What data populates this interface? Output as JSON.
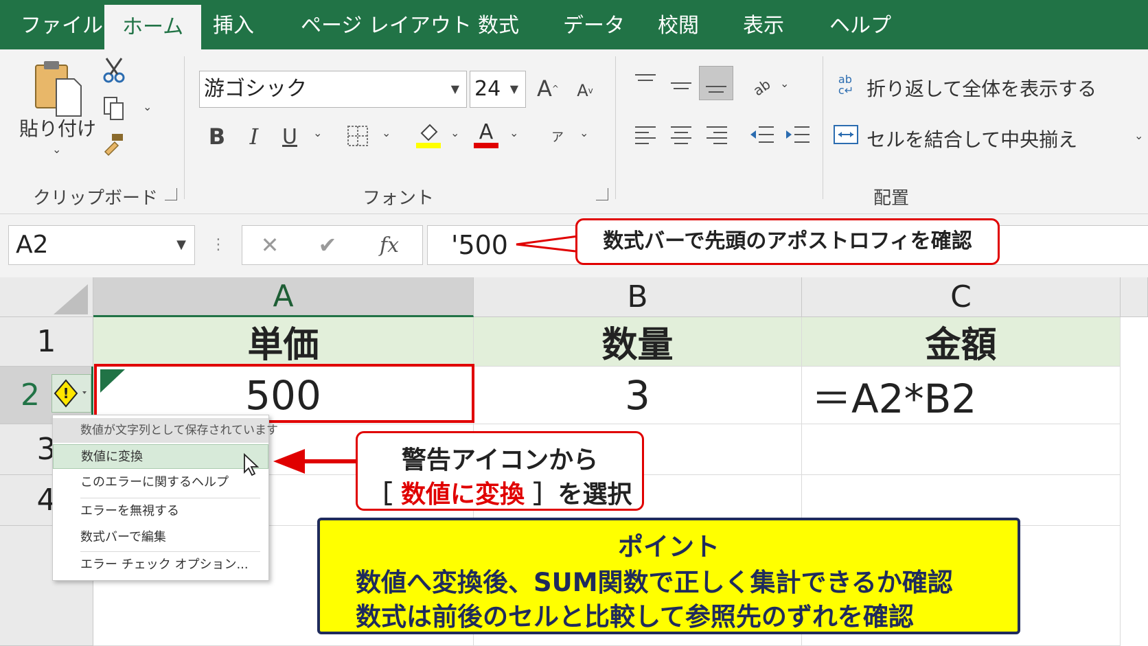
{
  "tabs": [
    "ファイル",
    "ホーム",
    "挿入",
    "ページ レイアウト",
    "数式",
    "データ",
    "校閲",
    "表示",
    "ヘルプ"
  ],
  "ribbon": {
    "clipboard": {
      "paste_label": "貼り付け",
      "group_label": "クリップボード"
    },
    "font": {
      "name": "游ゴシック",
      "size": "24",
      "group_label": "フォント"
    },
    "alignment": {
      "wrap_label": "折り返して全体を表示する",
      "merge_label": "セルを結合して中央揃え",
      "group_label": "配置"
    }
  },
  "formula_bar": {
    "name_box": "A2",
    "formula": "'500",
    "fx": "fx"
  },
  "grid": {
    "columns": [
      "A",
      "B",
      "C"
    ],
    "rows": [
      "1",
      "2",
      "3",
      "4"
    ],
    "header_row": [
      "単価",
      "数量",
      "金額"
    ],
    "row2": [
      "500",
      "3",
      "＝A2*B2"
    ]
  },
  "error_menu": {
    "title": "数値が文字列として保存されています",
    "items": [
      "数値に変換",
      "このエラーに関するヘルプ",
      "エラーを無視する",
      "数式バーで編集",
      "エラー チェック オプション..."
    ]
  },
  "callouts": {
    "formula_note": "数式バーで先頭のアポストロフィを確認",
    "menu_note_line1": "警告アイコンから",
    "menu_note_bracket_open": "［",
    "menu_note_action": "数値に変換",
    "menu_note_bracket_close": "］を選択",
    "point_title": "ポイント",
    "point_line1": "数値へ変換後、SUM関数で正しく集計できるか確認",
    "point_line2": "数式は前後のセルと比較して参照先のずれを確認"
  },
  "colors": {
    "excel_green": "#217346",
    "accent_red": "#e00000",
    "highlight_yellow": "#ffff00",
    "header_fill": "#e2efda"
  }
}
